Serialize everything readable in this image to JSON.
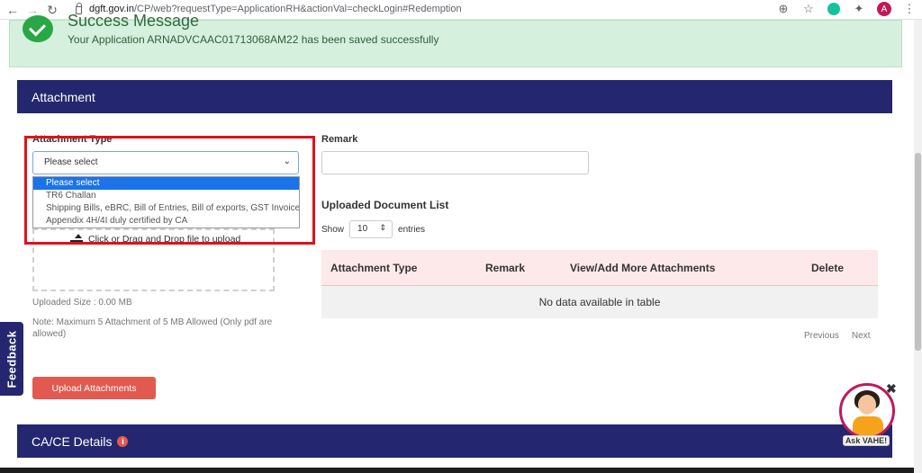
{
  "browser": {
    "url_domain": "dgft.gov.in",
    "url_path": "/CP/web?requestType=ApplicationRH&actionVal=checkLogin#Redemption",
    "avatar_letter": "A"
  },
  "success": {
    "title": "Success Message",
    "message": "Your Application ARNADVCAAC01713068AM22 has been saved successfully"
  },
  "attachment_panel": {
    "title": "Attachment",
    "type_label": "Attachment Type",
    "select_value": "Please select",
    "dropdown_options": [
      "Please select",
      "TR6 Challan",
      "Shipping Bills, eBRC, Bill of Entries, Bill of exports, GST Invoice",
      "Appendix 4H/4I duly certified by CA"
    ],
    "upload_label": "Click or Drag and Drop file to upload",
    "uploaded_size": "Uploaded Size : 0.00  MB",
    "note": "Note: Maximum 5 Attachment of 5 MB Allowed (Only pdf are allowed)",
    "upload_button": "Upload Attachments",
    "remark_label": "Remark",
    "doc_list_title": "Uploaded Document List",
    "show_label": "Show",
    "entries_value": "10",
    "entries_label": "entries",
    "table_headers": [
      "Attachment Type",
      "Remark",
      "View/Add More Attachments",
      "Delete"
    ],
    "empty_text": "No data available in table",
    "pager_prev": "Previous",
    "pager_next": "Next"
  },
  "feedback_label": "Feedback",
  "cace_title": "CA/CE Details",
  "assistant_label": "Ask VAHE!",
  "colors": {
    "header_navy": "#24276f",
    "success_bg": "#d6f0de",
    "button_red": "#e25a4f",
    "table_head_pink": "#fde9ea",
    "highlight_red": "#e0101d"
  }
}
